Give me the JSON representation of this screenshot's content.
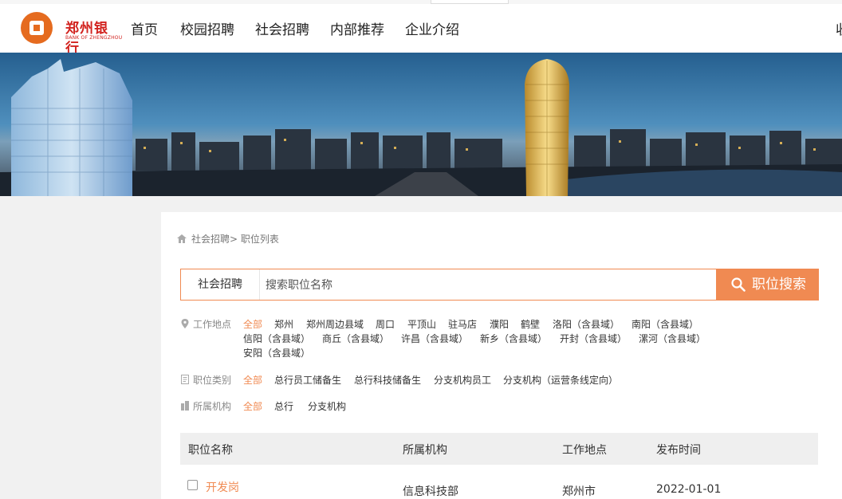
{
  "header": {
    "logo_cn": "郑州银行",
    "logo_en": "BANK OF ZHENGZHOU",
    "nav": [
      "首页",
      "校园招聘",
      "社会招聘",
      "内部推荐",
      "企业介绍"
    ],
    "nav_cut": "收"
  },
  "breadcrumb": {
    "text": "社会招聘> 职位列表"
  },
  "search": {
    "category": "社会招聘",
    "placeholder": "搜索职位名称",
    "button": "职位搜索"
  },
  "filters": {
    "location": {
      "label": "工作地点",
      "options": [
        "全部",
        "郑州",
        "郑州周边县域",
        "周口",
        "平顶山",
        "驻马店",
        "濮阳",
        "鹤壁",
        "洛阳（含县域）",
        "南阳（含县域）",
        "信阳（含县域）",
        "商丘（含县域）",
        "许昌（含县域）",
        "新乡（含县域）",
        "开封（含县域）",
        "漯河（含县域）",
        "安阳（含县域）"
      ]
    },
    "category": {
      "label": "职位类别",
      "options": [
        "全部",
        "总行员工储备生",
        "总行科技储备生",
        "分支机构员工",
        "分支机构（运营条线定向）"
      ]
    },
    "org": {
      "label": "所属机构",
      "options": [
        "全部",
        "总行",
        "分支机构"
      ]
    }
  },
  "table": {
    "columns": [
      "职位名称",
      "所属机构",
      "工作地点",
      "发布时间"
    ],
    "rows": [
      {
        "title": "开发岗",
        "org": "信息科技部",
        "location": "郑州市",
        "date": "2022-01-01"
      }
    ]
  },
  "colors": {
    "accent": "#f08a52",
    "brand_red": "#d2231f",
    "logo_orange": "#e56b1f"
  }
}
